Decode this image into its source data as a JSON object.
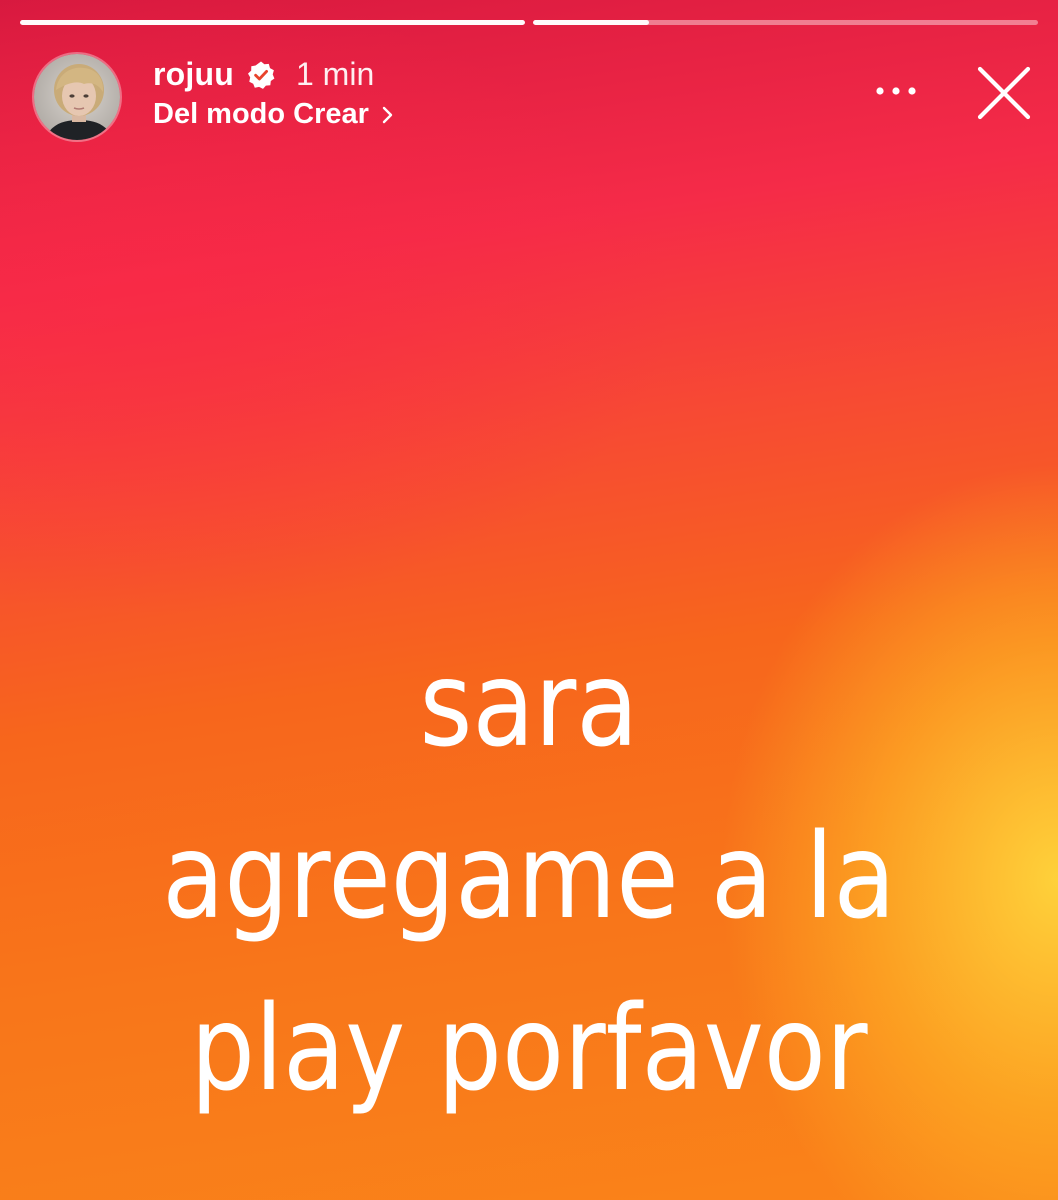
{
  "progress": {
    "segments": [
      {
        "fill": 1.0
      },
      {
        "fill": 0.23
      }
    ]
  },
  "header": {
    "username": "rojuu",
    "verified": true,
    "time": "1 min",
    "source": "Del modo Crear"
  },
  "icons": {
    "verified": "verified-badge-icon",
    "chevron": "chevron-right-icon",
    "more": "more-horizontal-icon",
    "close": "close-icon"
  },
  "story": {
    "lines": [
      "sara",
      "agregame a la",
      "play porfavor"
    ]
  },
  "colors": {
    "top": "#d8193f",
    "middle": "#f7661c",
    "glow": "#ffd63c",
    "text": "#ffffff"
  }
}
